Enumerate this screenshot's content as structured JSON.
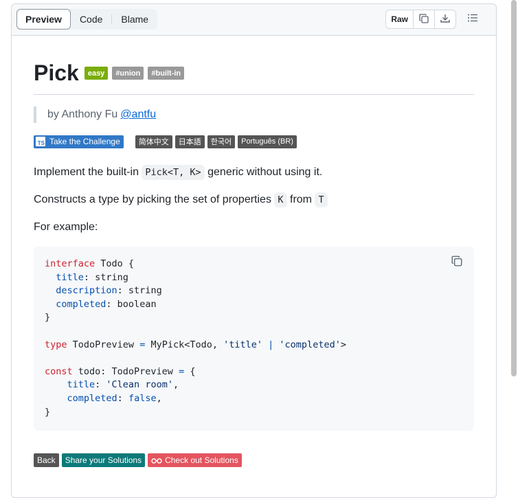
{
  "toolbar": {
    "tabs": [
      "Preview",
      "Code",
      "Blame"
    ],
    "raw_label": "Raw",
    "icons": [
      "copy-icon",
      "download-icon",
      "list-icon"
    ]
  },
  "title": "Pick",
  "tags": {
    "difficulty": "easy",
    "tag1": "#union",
    "tag2": "#built-in"
  },
  "author": {
    "prefix": "by Anthony Fu",
    "handle": "@antfu"
  },
  "challenge_label": "Take the Challenge",
  "ts_icon": "TS",
  "languages": [
    "简体中文",
    "日本語",
    "한국어",
    "Português (BR)"
  ],
  "description": {
    "p1_before": "Implement the built-in ",
    "p1_code": "Pick<T, K>",
    "p1_after": " generic without using it.",
    "p2_before": "Constructs a type by picking the set of properties ",
    "p2_code1": "K",
    "p2_mid": " from ",
    "p2_code2": "T",
    "p3": "For example:"
  },
  "code": {
    "kw_interface": "interface",
    "todo": " Todo {",
    "title_prop": "title",
    "title_type": ": string",
    "desc_prop": "description",
    "desc_type": ": string",
    "comp_prop": "completed",
    "comp_type": ": boolean",
    "close": "}",
    "kw_type": "type",
    "preview_name": " TodoPreview ",
    "eq": "=",
    "mypick": " MyPick<Todo, ",
    "str_title": "'title'",
    "pipe": " | ",
    "str_completed": "'completed'",
    "gt": ">",
    "kw_const": "const",
    "todo_var": " todo: TodoPreview ",
    "open": " {",
    "title_prop2": "title",
    "colon": ": ",
    "str_clean": "'Clean room'",
    "comma": ",",
    "comp_prop2": "completed",
    "false_val": "false"
  },
  "footer": {
    "back": "Back",
    "share": "Share your Solutions",
    "check": "Check out Solutions"
  }
}
